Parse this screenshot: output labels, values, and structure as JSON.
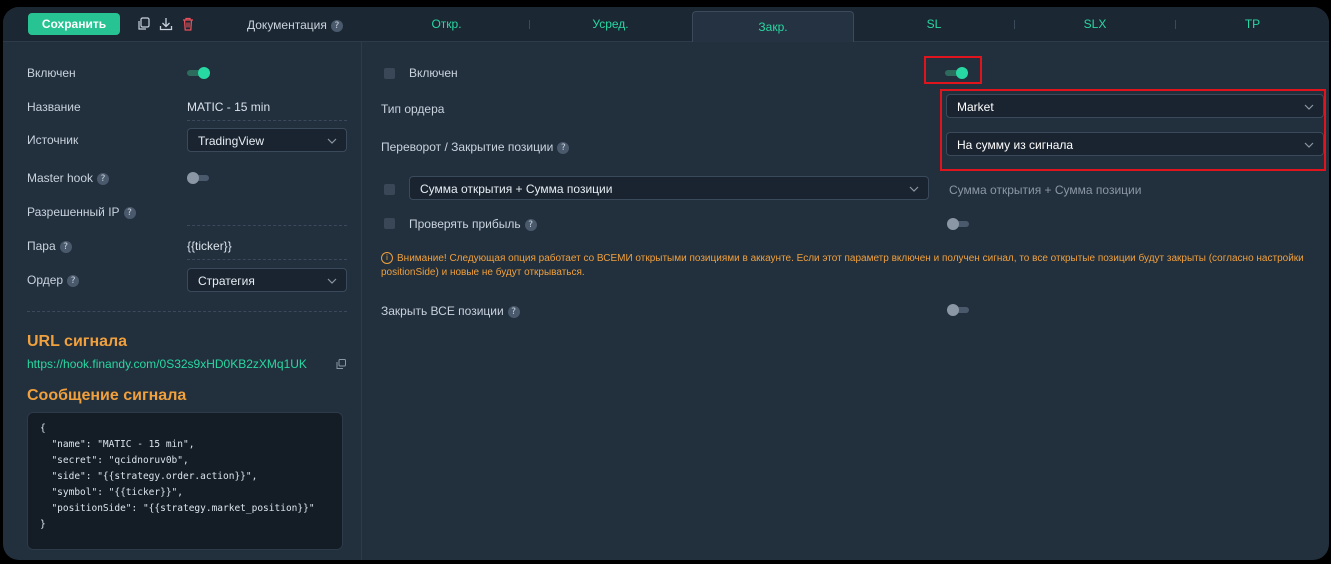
{
  "toolbar": {
    "save_label": "Сохранить",
    "doc_label": "Документация",
    "help_glyph": "?"
  },
  "tabs": [
    {
      "label": "Откр."
    },
    {
      "label": "Усред."
    },
    {
      "label": "Закр."
    },
    {
      "label": "SL"
    },
    {
      "label": "SLX"
    },
    {
      "label": "TP"
    }
  ],
  "active_tab": "Закр.",
  "left": {
    "enabled_label": "Включен",
    "enabled_on": true,
    "name_label": "Название",
    "name_value": "MATIC - 15 min",
    "source_label": "Источник",
    "source_value": "TradingView",
    "master_hook_label": "Master hook",
    "master_hook_on": false,
    "allowed_ip_label": "Разрешенный IP",
    "allowed_ip_value": "",
    "pair_label": "Пара",
    "pair_value": "{{ticker}}",
    "order_label": "Ордер",
    "order_value": "Стратегия",
    "url_title": "URL сигнала",
    "url_value": "https://hook.finandy.com/0S32s9xHD0KB2zXMq1UK",
    "message_title": "Сообщение сигнала",
    "message_lines": [
      "{",
      "  \"name\": \"MATIC - 15 min\",",
      "  \"secret\": \"qcidnoruv0b\",",
      "  \"side\": \"{{strategy.order.action}}\",",
      "  \"symbol\": \"{{ticker}}\",",
      "  \"positionSide\": \"{{strategy.market_position}}\"",
      "}"
    ]
  },
  "right": {
    "enabled_label": "Включен",
    "enabled_on": true,
    "order_type_label": "Тип ордера",
    "order_type_value": "Market",
    "reverse_label": "Переворот / Закрытие позиции",
    "reverse_value": "На сумму из сигнала",
    "sum_select_value": "Сумма открытия + Сумма позиции",
    "sum_hint": "Сумма открытия + Сумма позиции",
    "check_profit_label": "Проверять прибыль",
    "check_profit_on": false,
    "warning_icon": "i",
    "warning_text": "Внимание! Следующая опция работает со ВСЕМИ открытыми позициями в аккаунте. Если этот параметр включен и получен сигнал, то все открытые позиции будут закрыты (согласно настройки positionSide) и новые не будут открываться.",
    "close_all_label": "Закрыть ВСЕ позиции",
    "close_all_on": false
  },
  "colors": {
    "accent": "#27d8a2",
    "save_button": "#27c392",
    "warning": "#f0a03c",
    "highlight": "#e0141c",
    "panel": "#222f3d"
  }
}
